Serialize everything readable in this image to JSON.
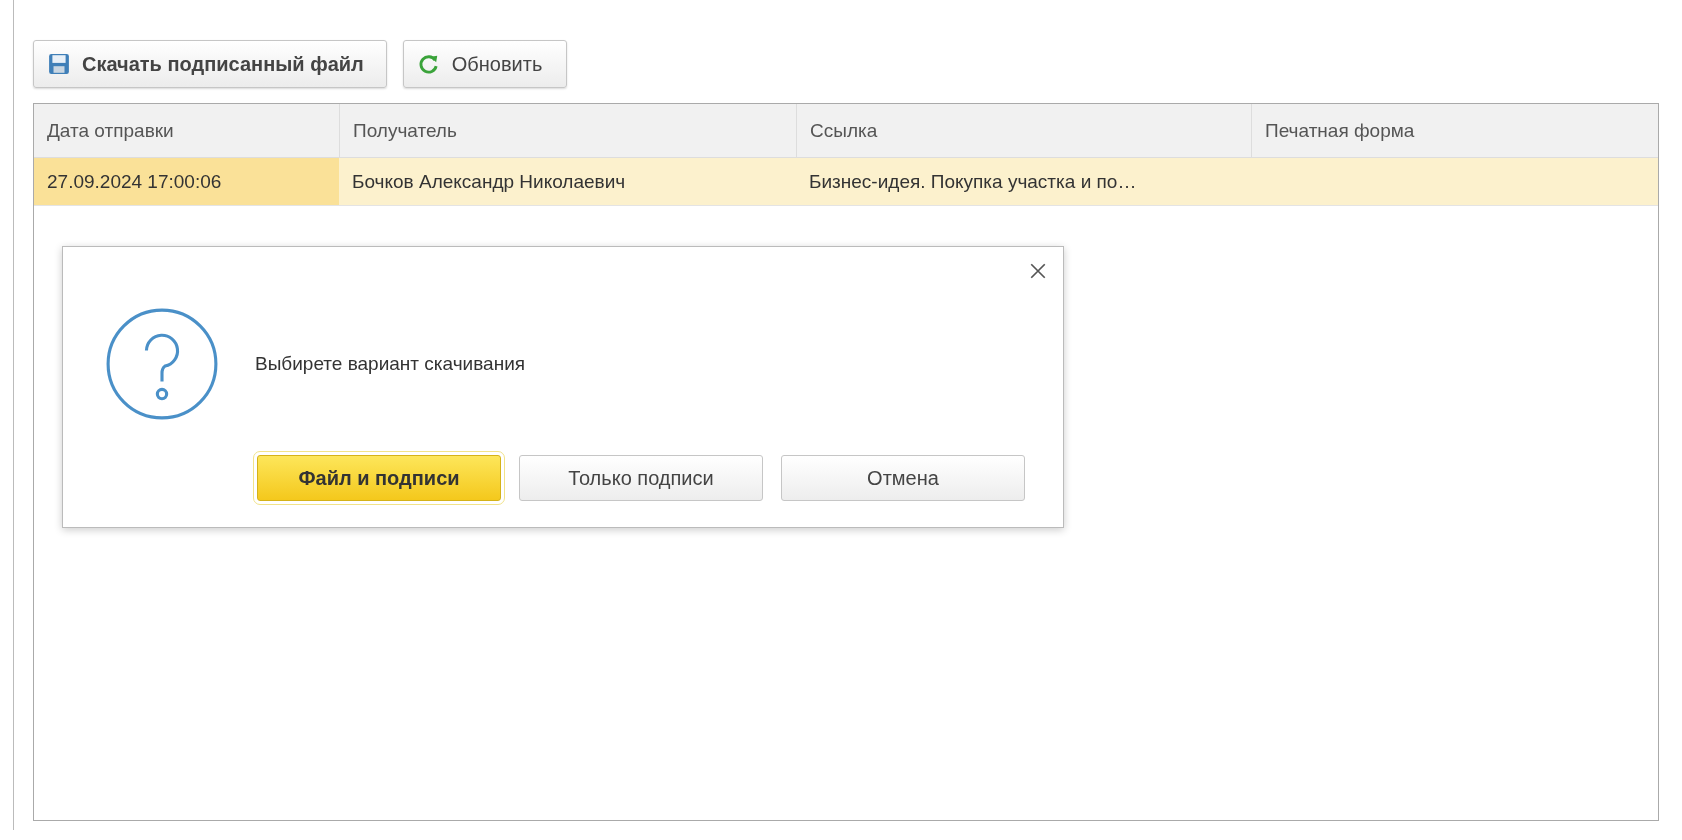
{
  "toolbar": {
    "buttons": [
      {
        "label": "Скачать подписанный файл",
        "kind": "save"
      },
      {
        "label": "Обновить",
        "kind": "refresh"
      }
    ]
  },
  "table": {
    "columns": [
      "Дата отправки",
      "Получатель",
      "Ссылка",
      "Печатная форма"
    ],
    "rows": [
      {
        "selected": true,
        "cells": [
          {
            "text": "27.09.2024 17:00:06",
            "focused": true
          },
          {
            "text": "Бочков Александр Николаевич",
            "focused": false
          },
          {
            "text": "Бизнес-идея. Покупка участка и по…",
            "focused": false
          },
          {
            "focused": false
          }
        ]
      }
    ]
  },
  "dialog": {
    "message": "Выбирете вариант скачивания",
    "buttons": [
      {
        "label": "Файл и подписи",
        "default": true
      },
      {
        "label": "Только подписи",
        "default": false
      },
      {
        "label": "Отмена",
        "default": false
      }
    ]
  }
}
